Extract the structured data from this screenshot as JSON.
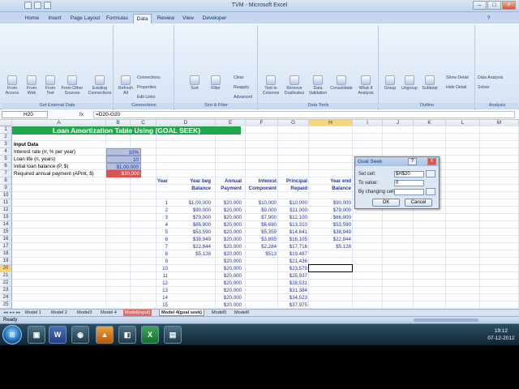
{
  "window": {
    "title": "TVM - Microsoft Excel"
  },
  "tabs": [
    "Home",
    "Insert",
    "Page Layout",
    "Formulas",
    "Data",
    "Review",
    "View",
    "Developer"
  ],
  "ribbon": {
    "groups": [
      {
        "label": "Get External Data",
        "buttons": [
          "From Access",
          "From Web",
          "From Text",
          "From Other Sources",
          "Existing Connections"
        ]
      },
      {
        "label": "Connections",
        "buttons": [
          "Refresh All"
        ],
        "small": [
          "Connections",
          "Properties",
          "Edit Links"
        ]
      },
      {
        "label": "Sort & Filter",
        "buttons": [
          "Sort",
          "Filter"
        ],
        "small": [
          "Clear",
          "Reapply",
          "Advanced"
        ]
      },
      {
        "label": "Data Tools",
        "buttons": [
          "Text to Columns",
          "Remove Duplicates",
          "Data Validation",
          "Consolidate",
          "What-If Analysis"
        ]
      },
      {
        "label": "Outline",
        "buttons": [
          "Group",
          "Ungroup",
          "Subtotal"
        ],
        "small": [
          "Show Detail",
          "Hide Detail"
        ]
      },
      {
        "label": "Analysis",
        "small": [
          "Data Analysis",
          "Solver"
        ]
      }
    ]
  },
  "formula_bar": {
    "name_box": "H20",
    "fx": "fx",
    "formula": "=D20-G20"
  },
  "columns": [
    "A",
    "B",
    "C",
    "D",
    "E",
    "F",
    "G",
    "H",
    "I",
    "J",
    "K",
    "L",
    "M"
  ],
  "rows": [
    "1",
    "2",
    "3",
    "4",
    "5",
    "6",
    "7",
    "8",
    "9",
    "10",
    "11",
    "12",
    "13",
    "14",
    "15",
    "16",
    "17",
    "18",
    "19",
    "20",
    "21",
    "22",
    "23",
    "24",
    "25"
  ],
  "sheet": {
    "title": "Loan Amortization Table Using (GOAL SEEK)",
    "input_header": "Input Data",
    "inputs": [
      {
        "label": "Interest rate (rr, % per year)",
        "value": "10%"
      },
      {
        "label": "Loan life (n, years)",
        "value": "10"
      },
      {
        "label": "Initial loan balance (P, $)",
        "value": "$1,00,000"
      },
      {
        "label": "Required annual payment (APmt, $)",
        "value": "$20,000"
      }
    ],
    "headers": {
      "year": [
        "Year",
        ""
      ],
      "begbal": [
        "Year beg",
        "Balance"
      ],
      "payment": [
        "Annual",
        "Payment"
      ],
      "interest": [
        "Interest",
        "Component"
      ],
      "principal": [
        "Principal",
        "Repaid"
      ],
      "endbal": [
        "Year end",
        "Balance"
      ]
    },
    "table": [
      [
        "1",
        "$1,00,000",
        "$20,000",
        "$10,000",
        "$10,000",
        "$90,000"
      ],
      [
        "2",
        "$90,000",
        "$20,000",
        "$9,000",
        "$11,000",
        "$79,000"
      ],
      [
        "3",
        "$79,000",
        "$20,000",
        "$7,900",
        "$12,100",
        "$66,900"
      ],
      [
        "4",
        "$66,900",
        "$20,000",
        "$6,690",
        "$13,310",
        "$53,590"
      ],
      [
        "5",
        "$53,590",
        "$20,000",
        "$5,359",
        "$14,641",
        "$38,949"
      ],
      [
        "6",
        "$38,949",
        "$20,000",
        "$3,895",
        "$16,105",
        "$22,844"
      ],
      [
        "7",
        "$22,844",
        "$20,000",
        "$2,284",
        "$17,716",
        "$5,128"
      ],
      [
        "8",
        "$5,128",
        "$20,000",
        "$513",
        "$19,487",
        ""
      ],
      [
        "9",
        "",
        "$20,000",
        "",
        "$21,436",
        ""
      ],
      [
        "10",
        "",
        "$20,000",
        "",
        "$23,579",
        ""
      ],
      [
        "11",
        "",
        "$20,000",
        "",
        "$25,937",
        ""
      ],
      [
        "12",
        "",
        "$20,000",
        "",
        "$28,531",
        ""
      ],
      [
        "13",
        "",
        "$20,000",
        "",
        "$31,384",
        ""
      ],
      [
        "14",
        "",
        "$20,000",
        "",
        "$34,523",
        ""
      ],
      [
        "15",
        "",
        "$20,000",
        "",
        "$37,975",
        ""
      ]
    ]
  },
  "sheet_tabs": [
    "Model 1",
    "Model 2",
    "Model3",
    "Model 4",
    "Model(input)",
    "Model 4(goal seek)",
    "Model5",
    "Model6"
  ],
  "active_sheet": "Model 4(goal seek)",
  "status": "Ready",
  "goal_seek": {
    "title": "Goal Seek",
    "set_cell_label": "Set cell:",
    "set_cell_value": "$H$20",
    "to_value_label": "To value:",
    "to_value_value": "0",
    "changing_label": "By changing cell:",
    "changing_value": "",
    "ok": "OK",
    "cancel": "Cancel",
    "help": "?",
    "close": "X"
  },
  "clock": {
    "time": "19:12",
    "date": "07-12-2012"
  },
  "colors": {
    "title_green": "#22a84a",
    "input_blue": "#b5c0e0",
    "payment_red": "#d9534f",
    "value_blue": "#1f33a8"
  }
}
